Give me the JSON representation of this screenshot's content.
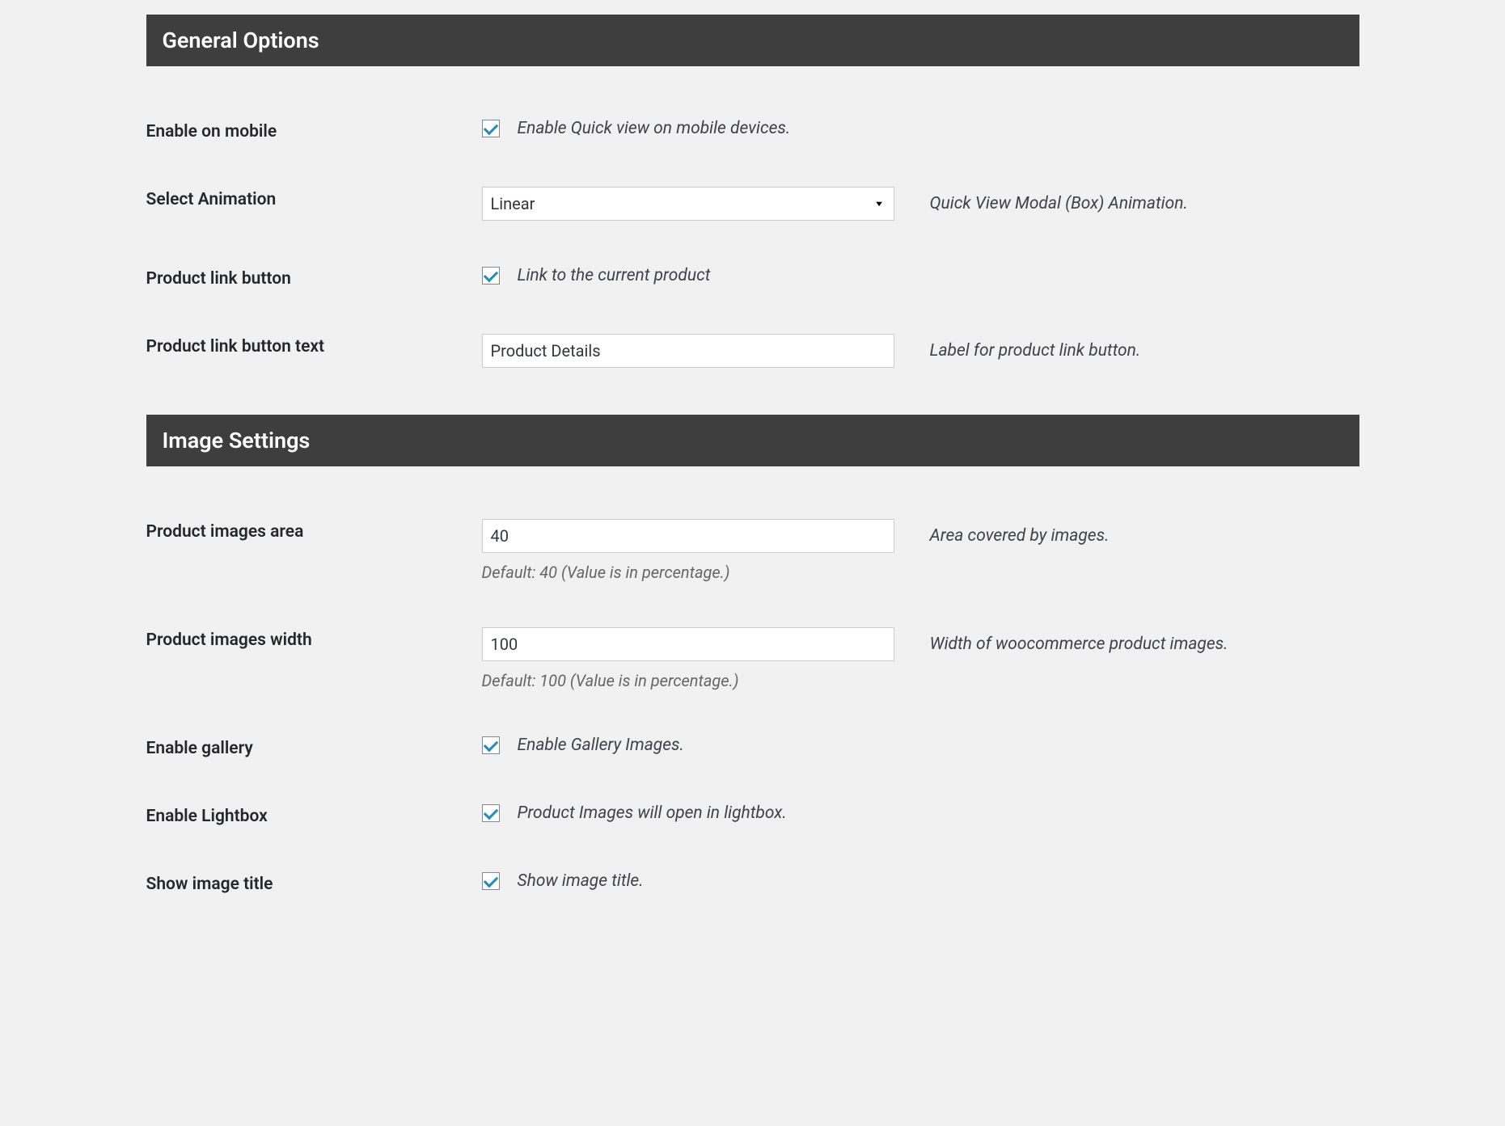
{
  "sections": {
    "general": {
      "title": "General Options",
      "enableMobile": {
        "label": "Enable on mobile",
        "checked": true,
        "description": "Enable Quick view on mobile devices."
      },
      "selectAnimation": {
        "label": "Select Animation",
        "value": "Linear",
        "description": "Quick View Modal (Box) Animation."
      },
      "productLinkButton": {
        "label": "Product link button",
        "checked": true,
        "description": "Link to the current product"
      },
      "productLinkButtonText": {
        "label": "Product link button text",
        "value": "Product Details",
        "description": "Label for product link button."
      }
    },
    "image": {
      "title": "Image Settings",
      "productImagesArea": {
        "label": "Product images area",
        "value": "40",
        "description": "Area covered by images.",
        "help": "Default: 40 (Value is in percentage.)"
      },
      "productImagesWidth": {
        "label": "Product images width",
        "value": "100",
        "description": "Width of woocommerce product images.",
        "help": "Default: 100 (Value is in percentage.)"
      },
      "enableGallery": {
        "label": "Enable gallery",
        "checked": true,
        "description": "Enable Gallery Images."
      },
      "enableLightbox": {
        "label": "Enable Lightbox",
        "checked": true,
        "description": "Product Images will open in lightbox."
      },
      "showImageTitle": {
        "label": "Show image title",
        "checked": true,
        "description": "Show image title."
      }
    }
  }
}
